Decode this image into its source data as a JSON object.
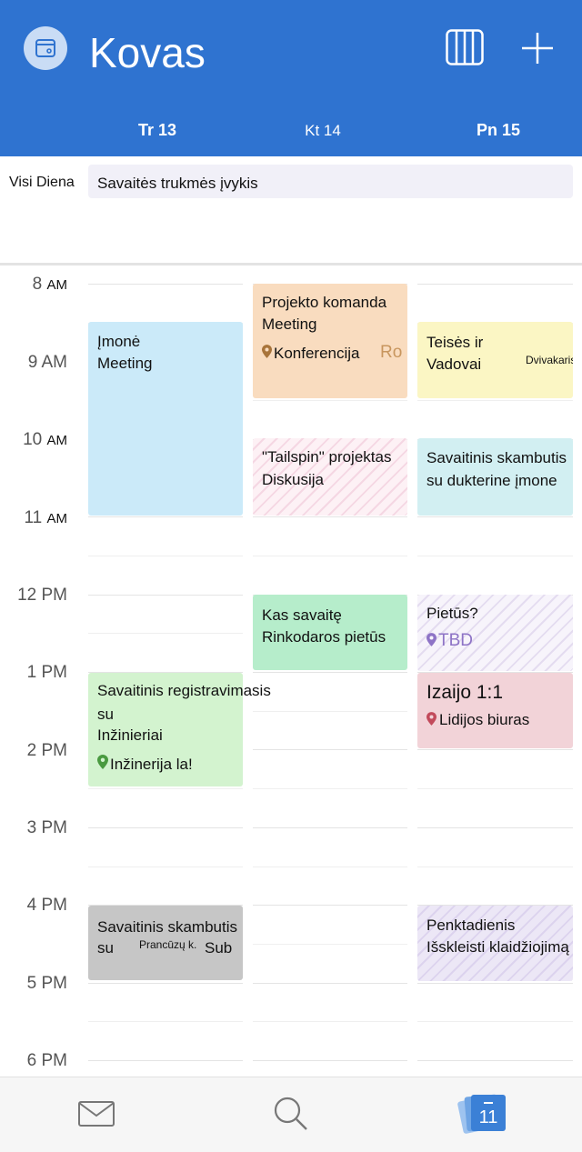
{
  "header": {
    "title": "Kovas",
    "accent": "#2f73d0"
  },
  "days": [
    "Tr 13",
    "Kt 14",
    "Pn 15"
  ],
  "allday": {
    "label": "Visi Diena",
    "event": "Savaitės trukmės įvykis"
  },
  "hours": [
    {
      "h": "8",
      "ap": "AM"
    },
    {
      "h": "9",
      "ap": "AM"
    },
    {
      "h": "10",
      "ap": "AM"
    },
    {
      "h": "11",
      "ap": "AM"
    },
    {
      "h": "12",
      "ap": "PM"
    },
    {
      "h": "1",
      "ap": "PM"
    },
    {
      "h": "2",
      "ap": "PM"
    },
    {
      "h": "3",
      "ap": "PM"
    },
    {
      "h": "4",
      "ap": "PM"
    },
    {
      "h": "5",
      "ap": "PM"
    },
    {
      "h": "6",
      "ap": "PM"
    }
  ],
  "events": {
    "imone": {
      "l1": "Įmonė",
      "l2": "Meeting"
    },
    "projekto": {
      "l1": "Projekto komanda",
      "l2": "Meeting",
      "loc": "Konferencija",
      "extra": "Ro"
    },
    "teises": {
      "l1": "Teisės ir",
      "l2": "Vadovai",
      "extra": "Dvivakaris"
    },
    "tailspin": {
      "l1": "\"Tailspin\" projektas",
      "l2": "Diskusija"
    },
    "skambutis": {
      "l1": "Savaitinis skambutis",
      "l2": "su dukterine įmone"
    },
    "kas": {
      "l1": "Kas savaitę",
      "l2": "Rinkodaros pietūs"
    },
    "pietus": {
      "l1": "Pietūs?",
      "loc": "TBD"
    },
    "registr": {
      "l1": "Savaitinis registravimasis",
      "l2": "su",
      "l3": "Inžinieriai",
      "loc": "Inžinerija la!"
    },
    "izaijo": {
      "l1": "Izaijo 1:1",
      "loc": "Lidijos biuras"
    },
    "skamb2": {
      "l1": "Savaitinis skambutis",
      "l2": "su",
      "small": "Prancūzų k.",
      "l3": "Sub"
    },
    "penkt": {
      "l1": "Penktadienis",
      "l2": "Išskleisti klaidžiojimą"
    }
  },
  "colors": {
    "blue": "#cbeaf9",
    "peach": "#f9dcbf",
    "yellow": "#fbf6c4",
    "teal": "#d2eff2",
    "green": "#b6edcb",
    "lightgreen": "#d3f3cf",
    "red": "#f2d3d8",
    "gray": "#c6c6c6"
  },
  "tabs": {
    "mail": "mail-icon",
    "search": "search-icon",
    "calendar": "11"
  }
}
